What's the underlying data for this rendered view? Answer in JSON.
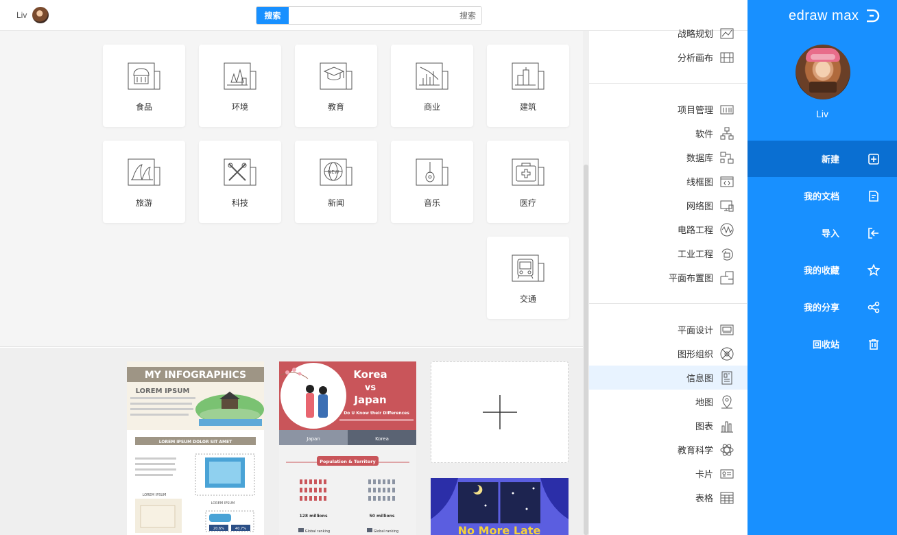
{
  "topbar": {
    "user_name": "Liv",
    "search_button": "搜索",
    "search_placeholder": "搜索"
  },
  "sidebar": {
    "brand": "edraw max",
    "user_name": "Liv",
    "nav": [
      {
        "label": "新建",
        "icon": "new-file-icon",
        "active": true
      },
      {
        "label": "我的文档",
        "icon": "documents-icon"
      },
      {
        "label": "导入",
        "icon": "import-icon"
      },
      {
        "label": "我的收藏",
        "icon": "star-icon"
      },
      {
        "label": "我的分享",
        "icon": "share-icon"
      },
      {
        "label": "回收站",
        "icon": "trash-icon"
      }
    ]
  },
  "categories": {
    "group1": [
      {
        "label": "战略规划",
        "icon": "strategy-icon"
      },
      {
        "label": "分析画布",
        "icon": "canvas-icon"
      }
    ],
    "group2": [
      {
        "label": "项目管理",
        "icon": "project-icon"
      },
      {
        "label": "软件",
        "icon": "software-icon"
      },
      {
        "label": "数据库",
        "icon": "database-icon"
      },
      {
        "label": "线框图",
        "icon": "wireframe-icon"
      },
      {
        "label": "网络图",
        "icon": "network-icon"
      },
      {
        "label": "电路工程",
        "icon": "circuit-icon"
      },
      {
        "label": "工业工程",
        "icon": "industrial-icon"
      },
      {
        "label": "平面布置图",
        "icon": "floorplan-icon"
      }
    ],
    "group3": [
      {
        "label": "平面设计",
        "icon": "graphic-design-icon"
      },
      {
        "label": "图形组织",
        "icon": "graphic-organizer-icon"
      },
      {
        "label": "信息图",
        "icon": "infographic-icon",
        "active": true
      },
      {
        "label": "地图",
        "icon": "map-icon"
      },
      {
        "label": "图表",
        "icon": "chart-icon"
      },
      {
        "label": "教育科学",
        "icon": "science-icon"
      },
      {
        "label": "卡片",
        "icon": "card-icon"
      },
      {
        "label": "表格",
        "icon": "table-icon"
      }
    ]
  },
  "template_cards": [
    {
      "label": "建筑",
      "icon": "building-icon"
    },
    {
      "label": "商业",
      "icon": "business-icon"
    },
    {
      "label": "教育",
      "icon": "education-icon"
    },
    {
      "label": "环境",
      "icon": "environment-icon"
    },
    {
      "label": "食品",
      "icon": "food-icon"
    },
    {
      "label": "医疗",
      "icon": "medical-icon"
    },
    {
      "label": "音乐",
      "icon": "music-icon"
    },
    {
      "label": "新闻",
      "icon": "news-icon"
    },
    {
      "label": "科技",
      "icon": "technology-icon"
    },
    {
      "label": "旅游",
      "icon": "travel-icon"
    },
    {
      "label": "交通",
      "icon": "traffic-icon"
    }
  ],
  "templates": {
    "infographic1": {
      "title": "MY INFOGRAPHICS",
      "subtitle": "LOREM IPSUM",
      "banner": "LOREM IPSUM DOLOR SIT AMET",
      "label_a": "LOREM IPSUM",
      "label_b": "LOREM IPSUM",
      "stat_a": "20.6%",
      "stat_b": "40.7%"
    },
    "infographic2": {
      "title_line1": "Korea",
      "title_line2": "vs",
      "title_line3": "Japan",
      "tagline": "Do U Know their Differences",
      "tab_left": "Japan",
      "tab_right": "Korea",
      "section": "Population & Territory",
      "stat_left": "128 millions",
      "stat_right": "50 millions",
      "rank_left": "Global ranking",
      "rank_right": "Global ranking"
    },
    "infographic3": {
      "title": "No More Late"
    }
  }
}
